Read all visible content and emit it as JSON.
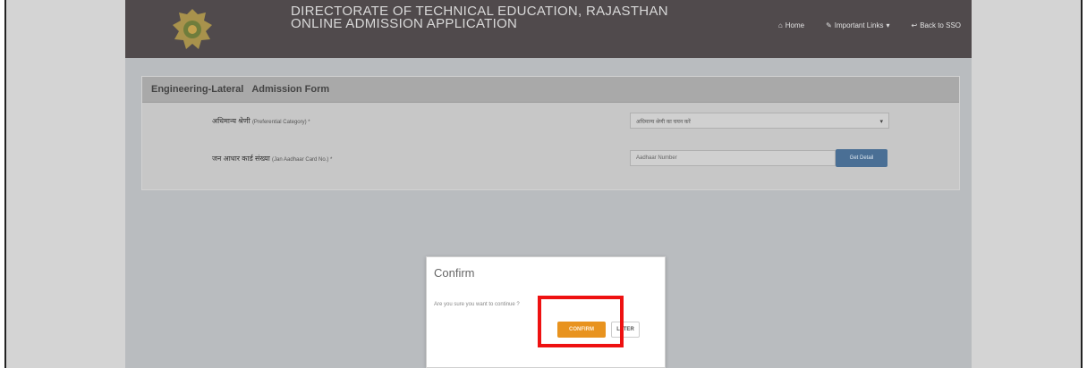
{
  "header": {
    "title_line1": "DIRECTORATE OF TECHNICAL EDUCATION, RAJASTHAN",
    "title_line2": "ONLINE ADMISSION APPLICATION",
    "nav": {
      "home": "Home",
      "important_links": "Important Links",
      "back_to_sso": "Back to SSO"
    }
  },
  "form": {
    "heading": "Engineering-Lateral",
    "subheading": "Admission Form",
    "category_label": "अधिमान्य श्रेणी",
    "category_label_en": "(Preferential Category) *",
    "category_value": "अधिमान्य श्रेणी का चयन करें",
    "aadhaar_label": "जन आधार कार्ड संख्या",
    "aadhaar_label_en": "(Jan Aadhaar Card No.) *",
    "aadhaar_placeholder": "Aadhaar Number",
    "get_button": "Get Detail"
  },
  "modal": {
    "title": "Confirm",
    "message": "Are you sure you want to continue ?",
    "confirm_label": "CONFIRM",
    "later_label": "LATER"
  },
  "colors": {
    "header_bg": "#504a4c",
    "confirm_accent": "#e8931f",
    "highlight": "#ee1111"
  }
}
